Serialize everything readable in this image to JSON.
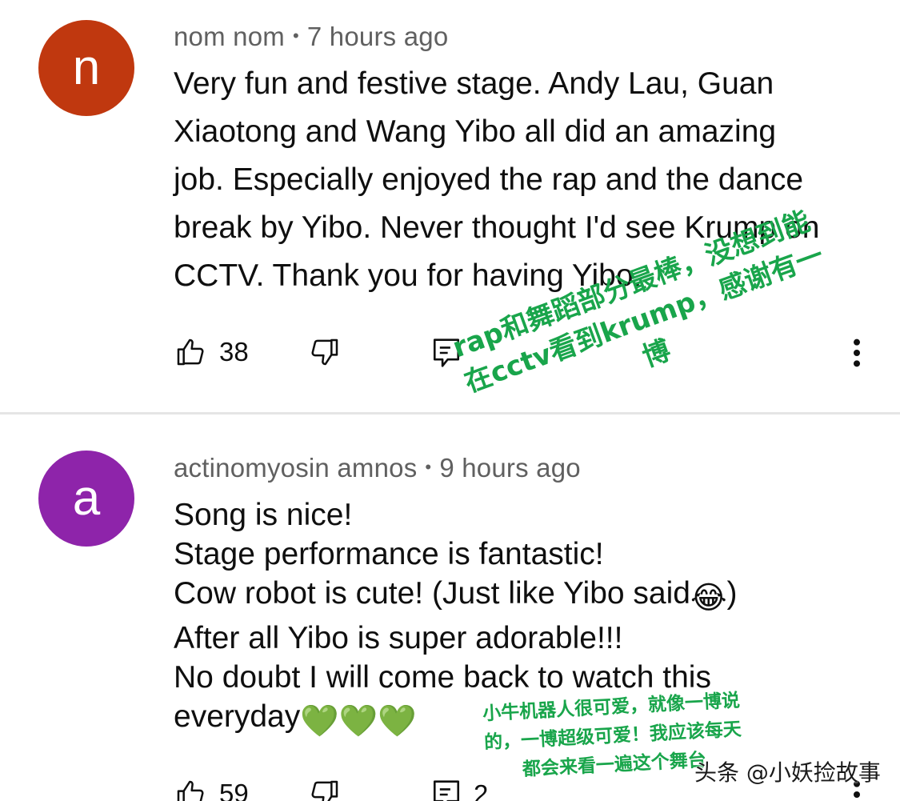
{
  "comments": [
    {
      "avatar": {
        "letter": "n",
        "color": "#c0380f"
      },
      "author": "nom nom",
      "separator": "•",
      "time": "7 hours ago",
      "lines": [
        "Very fun and festive stage. Andy Lau, Guan",
        "Xiaotong and Wang Yibo all did an amazing",
        "job. Especially enjoyed the rap and the dance",
        "break by Yibo. Never thought I'd see Krump on",
        "CCTV. Thank you for having Yibo."
      ],
      "likes": "38",
      "actions": {
        "like_icon": "thumbs-up-icon",
        "dislike_icon": "thumbs-down-icon",
        "reply_icon": "reply-icon",
        "more_icon": "more-vertical-icon"
      }
    },
    {
      "avatar": {
        "letter": "a",
        "color": "#8e24aa"
      },
      "author": "actinomyosin amnos",
      "separator": "•",
      "time": "9 hours ago",
      "lines": [
        "Song is nice!",
        "Stage performance is fantastic!",
        "Cow robot is cute! (Just like Yibo said",
        "After all Yibo is super adorable!!!",
        "No doubt I will come back to watch this",
        "everyday"
      ],
      "line3_suffix": ")",
      "emojis": {
        "laughing": "😂",
        "hearts": "💚💚💚"
      },
      "likes": "59",
      "replies": "2",
      "actions": {
        "like_icon": "thumbs-up-icon",
        "dislike_icon": "thumbs-down-icon",
        "reply_icon": "reply-icon",
        "more_icon": "more-vertical-icon"
      }
    }
  ],
  "annotations": {
    "first": [
      "rap和舞蹈部分最棒，没想到能",
      "在cctv看到krump，感谢有一",
      "博"
    ],
    "second": [
      "小牛机器人很可爱，就像一博说",
      "的，一博超级可爱！我应该每天",
      "都会来看一遍这个舞台"
    ],
    "color": "#19a54b"
  },
  "watermark": "头条 @小妖捡故事"
}
